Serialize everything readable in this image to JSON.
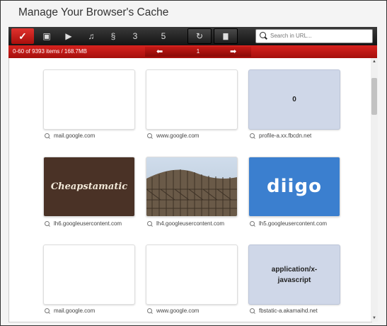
{
  "window": {
    "title": "Manage Your Browser's Cache"
  },
  "toolbar": {
    "buttons": [
      {
        "icon": "check-icon",
        "glyph": "✓"
      },
      {
        "icon": "image-icon",
        "glyph": "▣"
      },
      {
        "icon": "video-icon",
        "glyph": "▶"
      },
      {
        "icon": "music-icon",
        "glyph": "♫"
      },
      {
        "icon": "script-icon",
        "glyph": "§"
      },
      {
        "icon": "css-icon",
        "glyph": "3"
      },
      {
        "icon": "html-icon",
        "glyph": "5"
      }
    ],
    "refresh_glyph": "↻",
    "delete_glyph": "▇",
    "search_placeholder": "Search in URL..."
  },
  "status": {
    "info": "0-60 of 9393 items / 168.7MB",
    "page": "1",
    "prev": "⬅",
    "next": "➡"
  },
  "tiles": [
    {
      "kind": "blank",
      "caption": "mail.google.com"
    },
    {
      "kind": "blank",
      "caption": "www.google.com"
    },
    {
      "kind": "text",
      "text": "0",
      "caption": "profile-a.xx.fbcdn.net"
    },
    {
      "kind": "image-cheap",
      "text": "Cheapstamatic",
      "caption": "lh6.googleusercontent.com"
    },
    {
      "kind": "image-coaster",
      "caption": "lh4.googleusercontent.com"
    },
    {
      "kind": "image-diigo",
      "text": "diigo",
      "caption": "lh5.googleusercontent.com"
    },
    {
      "kind": "blank",
      "caption": "mail.google.com"
    },
    {
      "kind": "blank",
      "caption": "www.google.com"
    },
    {
      "kind": "text",
      "text": "application/x-javascript",
      "caption": "fbstatic-a.akamaihd.net"
    }
  ],
  "colors": {
    "accent": "#c8201c",
    "toolbar": "#1e1e1e",
    "placeholder_tile": "#cfd7e8"
  }
}
